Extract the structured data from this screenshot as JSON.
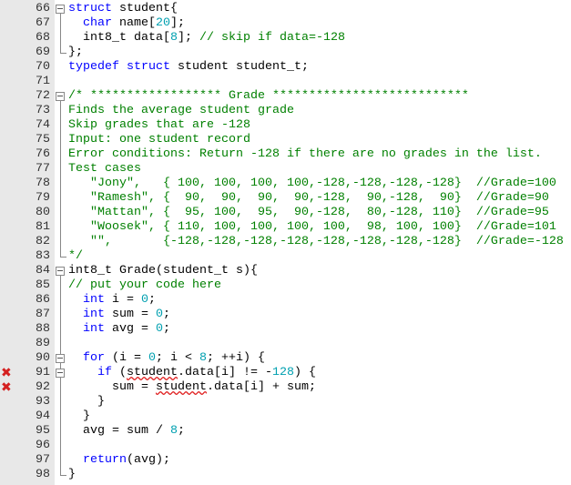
{
  "editor": {
    "lines": [
      {
        "n": "66",
        "fold": "start",
        "t": [
          [
            "kw",
            "struct"
          ],
          [
            "",
            " student{"
          ]
        ]
      },
      {
        "n": "67",
        "fold": "mid",
        "t": [
          [
            "",
            "  "
          ],
          [
            "kw",
            "char"
          ],
          [
            "",
            " name["
          ],
          [
            "nm",
            "20"
          ],
          [
            "",
            "];"
          ]
        ]
      },
      {
        "n": "68",
        "fold": "mid",
        "t": [
          [
            "",
            "  int8_t data["
          ],
          [
            "nm",
            "8"
          ],
          [
            "",
            "]; "
          ],
          [
            "cm",
            "// skip if data=-128"
          ]
        ]
      },
      {
        "n": "69",
        "fold": "end",
        "t": [
          [
            "",
            "};"
          ]
        ]
      },
      {
        "n": "70",
        "t": [
          [
            "kw",
            "typedef struct"
          ],
          [
            "",
            " student student_t;"
          ]
        ]
      },
      {
        "n": "71",
        "t": []
      },
      {
        "n": "72",
        "fold": "start",
        "t": [
          [
            "cm",
            "/* ****************** Grade ***************************"
          ]
        ]
      },
      {
        "n": "73",
        "fold": "mid",
        "t": [
          [
            "cm",
            "Finds the average student grade"
          ]
        ]
      },
      {
        "n": "74",
        "fold": "mid",
        "t": [
          [
            "cm",
            "Skip grades that are -128"
          ]
        ]
      },
      {
        "n": "75",
        "fold": "mid",
        "t": [
          [
            "cm",
            "Input: one student record"
          ]
        ]
      },
      {
        "n": "76",
        "fold": "mid",
        "t": [
          [
            "cm",
            "Error conditions: Return -128 if there are no grades in the list."
          ]
        ]
      },
      {
        "n": "77",
        "fold": "mid",
        "t": [
          [
            "cm",
            "Test cases"
          ]
        ]
      },
      {
        "n": "78",
        "fold": "mid",
        "t": [
          [
            "cm",
            "   \"Jony\",   { 100, 100, 100, 100,-128,-128,-128,-128}  //Grade=100"
          ]
        ]
      },
      {
        "n": "79",
        "fold": "mid",
        "t": [
          [
            "cm",
            "   \"Ramesh\", {  90,  90,  90,  90,-128,  90,-128,  90}  //Grade=90"
          ]
        ]
      },
      {
        "n": "80",
        "fold": "mid",
        "t": [
          [
            "cm",
            "   \"Mattan\", {  95, 100,  95,  90,-128,  80,-128, 110}  //Grade=95"
          ]
        ]
      },
      {
        "n": "81",
        "fold": "mid",
        "t": [
          [
            "cm",
            "   \"Woosek\", { 110, 100, 100, 100, 100,  98, 100, 100}  //Grade=101"
          ]
        ]
      },
      {
        "n": "82",
        "fold": "mid",
        "t": [
          [
            "cm",
            "   \"\",       {-128,-128,-128,-128,-128,-128,-128,-128}  //Grade=-128"
          ]
        ]
      },
      {
        "n": "83",
        "fold": "end",
        "t": [
          [
            "cm",
            "*/"
          ]
        ]
      },
      {
        "n": "84",
        "fold": "start",
        "t": [
          [
            "",
            "int8_t Grade(student_t s){"
          ]
        ]
      },
      {
        "n": "85",
        "fold": "mid",
        "t": [
          [
            "cm",
            "// put your code here"
          ]
        ]
      },
      {
        "n": "86",
        "fold": "mid",
        "t": [
          [
            "",
            "  "
          ],
          [
            "kw",
            "int"
          ],
          [
            "",
            " i = "
          ],
          [
            "nm",
            "0"
          ],
          [
            "",
            ";"
          ]
        ]
      },
      {
        "n": "87",
        "fold": "mid",
        "t": [
          [
            "",
            "  "
          ],
          [
            "kw",
            "int"
          ],
          [
            "",
            " sum = "
          ],
          [
            "nm",
            "0"
          ],
          [
            "",
            ";"
          ]
        ]
      },
      {
        "n": "88",
        "fold": "mid",
        "t": [
          [
            "",
            "  "
          ],
          [
            "kw",
            "int"
          ],
          [
            "",
            " avg = "
          ],
          [
            "nm",
            "0"
          ],
          [
            "",
            ";"
          ]
        ]
      },
      {
        "n": "89",
        "fold": "mid",
        "t": []
      },
      {
        "n": "90",
        "fold": "start",
        "t": [
          [
            "",
            "  "
          ],
          [
            "kw",
            "for"
          ],
          [
            "",
            " (i = "
          ],
          [
            "nm",
            "0"
          ],
          [
            "",
            "; i < "
          ],
          [
            "nm",
            "8"
          ],
          [
            "",
            "; ++i) {"
          ]
        ]
      },
      {
        "n": "91",
        "fold": "start",
        "error": true,
        "t": [
          [
            "",
            "    "
          ],
          [
            "kw",
            "if"
          ],
          [
            "",
            " ("
          ],
          [
            "sq",
            "student"
          ],
          [
            "",
            ".data[i] != -"
          ],
          [
            "nm",
            "128"
          ],
          [
            "",
            ") {"
          ]
        ]
      },
      {
        "n": "92",
        "fold": "mid",
        "error": true,
        "t": [
          [
            "",
            "      sum = "
          ],
          [
            "sq",
            "student"
          ],
          [
            "",
            ".data[i] + sum;"
          ]
        ]
      },
      {
        "n": "93",
        "fold": "mid",
        "t": [
          [
            "",
            "    }"
          ]
        ]
      },
      {
        "n": "94",
        "fold": "mid",
        "t": [
          [
            "",
            "  }"
          ]
        ]
      },
      {
        "n": "95",
        "fold": "mid",
        "t": [
          [
            "",
            "  avg = sum / "
          ],
          [
            "nm",
            "8"
          ],
          [
            "",
            ";"
          ]
        ]
      },
      {
        "n": "96",
        "fold": "mid",
        "t": []
      },
      {
        "n": "97",
        "fold": "mid",
        "t": [
          [
            "",
            "  "
          ],
          [
            "kw",
            "return"
          ],
          [
            "",
            "(avg);"
          ]
        ]
      },
      {
        "n": "98",
        "fold": "end",
        "t": [
          [
            "",
            "}"
          ]
        ]
      }
    ],
    "error_icon": "✖",
    "colors": {
      "keyword": "#0000ff",
      "number": "#00a0b0",
      "comment": "#008000",
      "margin": "#e8e8e8"
    }
  }
}
